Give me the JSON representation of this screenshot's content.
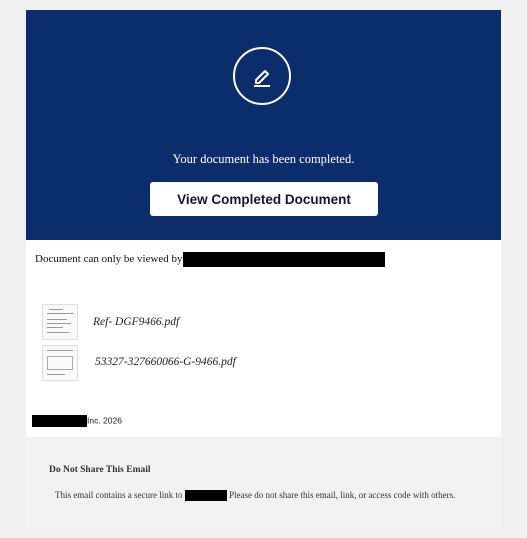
{
  "hero": {
    "icon": "pen-edit-icon",
    "message": "Your document has been completed.",
    "button_label": "View Completed Document",
    "background_color": "#0c2d6b"
  },
  "access": {
    "viewed_by_label": "Document can only be viewed by"
  },
  "attachments": [
    {
      "file_name": "Ref- DGF9466.pdf",
      "thumbnail": "document-thumbnail-icon"
    },
    {
      "file_name": "53327-327660066-G-9466.pdf",
      "thumbnail": "document-thumbnail-icon"
    }
  ],
  "footer": {
    "copyright": "Inc. 2026"
  },
  "notice": {
    "title": "Do Not Share This Email",
    "text_before": "This email contains a secure link to",
    "text_after": "Please do not share this email, link, or access code with others."
  }
}
